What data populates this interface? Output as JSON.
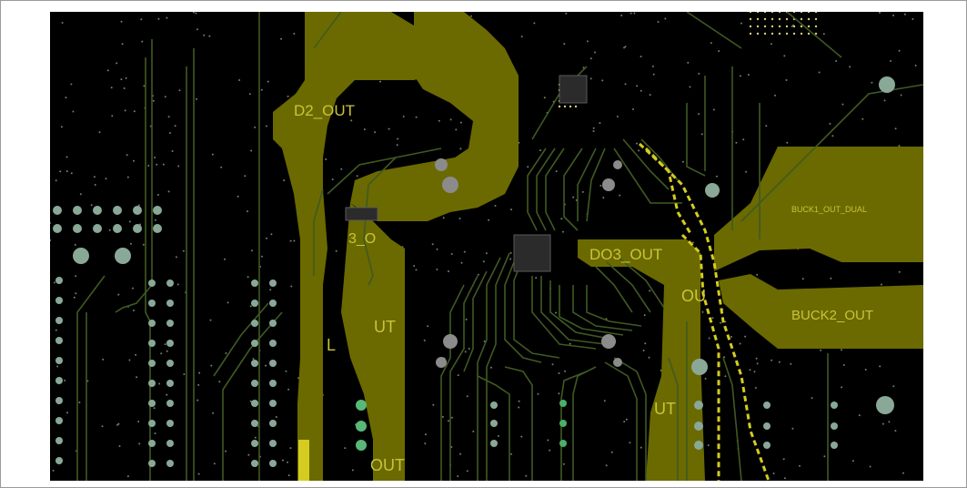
{
  "view": {
    "background_color": "#000000",
    "copper_color": "#6b6a00",
    "trace_color": "#3f5a22",
    "via_color": "#8aa898",
    "label_color": "#c9c43a"
  },
  "net_labels": {
    "do2_out": "D2_OUT",
    "do3_out": "DO3_OUT",
    "buck1_out_dual": "BUCK1_OUT_DUAL",
    "buck2_out": "BUCK2_OUT",
    "ldo_frag_1": "3_O",
    "ldo_frag_2": "UT",
    "ldo_frag_3": "L",
    "ldo_frag_4": "OUT",
    "out_frag_1": "OU",
    "out_frag_2": "UT"
  }
}
